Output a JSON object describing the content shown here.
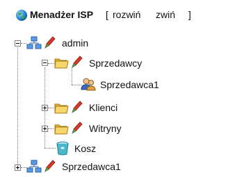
{
  "header": {
    "title": "Menadżer ISP",
    "open_bracket": "[",
    "expand_label": "rozwiń",
    "collapse_label": "zwiń",
    "close_bracket": "]"
  },
  "tree": {
    "admin": {
      "label": "admin",
      "expanded": true
    },
    "sprzedawcy": {
      "label": "Sprzedawcy",
      "expanded": true
    },
    "sprzedawca1_child": {
      "label": "Sprzedawca1"
    },
    "klienci": {
      "label": "Klienci",
      "expanded": false
    },
    "witryny": {
      "label": "Witryny",
      "expanded": false
    },
    "kosz": {
      "label": "Kosz"
    },
    "sprzedawca1_root": {
      "label": "Sprzedawca1",
      "expanded": false
    }
  },
  "colors": {
    "folder": "#f2c94c",
    "pencil": "#d83a2a",
    "globe": "#2f8fd8",
    "network": "#3b78c2",
    "trash": "#2a9fb4"
  }
}
